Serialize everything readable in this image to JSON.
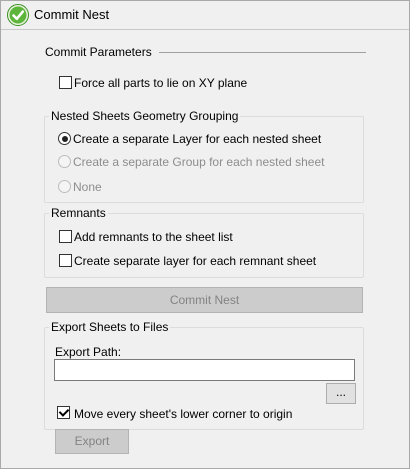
{
  "header": {
    "title": "Commit Nest"
  },
  "commit_parameters": {
    "heading": "Commit Parameters",
    "force_xy_label": "Force all parts to lie on XY plane",
    "force_xy_checked": false
  },
  "geometry_grouping": {
    "title": "Nested Sheets Geometry Grouping",
    "options": [
      {
        "label": "Create a separate Layer for each nested sheet",
        "selected": true,
        "enabled": true
      },
      {
        "label": "Create a separate Group for each nested sheet",
        "selected": false,
        "enabled": false
      },
      {
        "label": "None",
        "selected": false,
        "enabled": false
      }
    ]
  },
  "remnants": {
    "title": "Remnants",
    "add_label": "Add remnants to the sheet list",
    "add_checked": false,
    "separate_layer_label": "Create separate layer for each remnant sheet",
    "separate_layer_checked": false
  },
  "commit_button": {
    "label": "Commit Nest"
  },
  "export": {
    "title": "Export Sheets to Files",
    "path_label": "Export Path:",
    "path_value": "",
    "browse_label": "...",
    "move_origin_label": "Move every sheet's  lower corner to origin",
    "move_origin_checked": true,
    "export_button_label": "Export"
  },
  "colors": {
    "icon_green": "#4caf35",
    "disabled_button": "#cccccc"
  }
}
